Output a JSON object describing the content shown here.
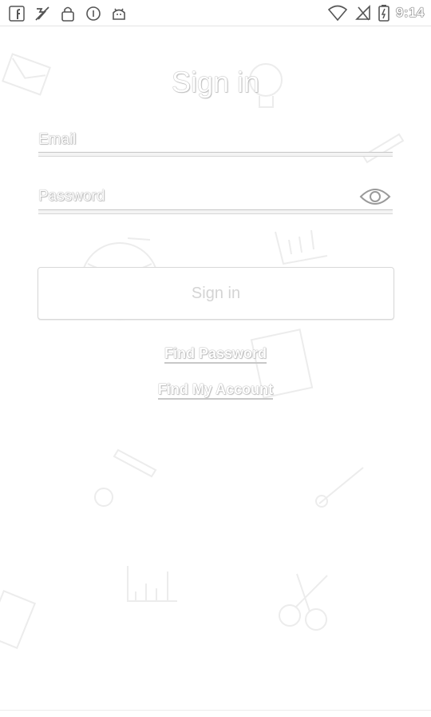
{
  "status_bar": {
    "time": "9:14",
    "left_icons": [
      "facebook-icon",
      "no-sim-icon",
      "lock-icon",
      "circle-app-icon",
      "android-icon"
    ],
    "right_icons": [
      "wifi-icon",
      "no-signal-icon",
      "battery-charging-icon"
    ]
  },
  "screen": {
    "title": "Sign in",
    "email_placeholder": "Email",
    "password_placeholder": "Password",
    "signin_button": "Sign in",
    "find_password": "Find Password",
    "find_account": "Find My Account"
  },
  "colors": {
    "background": "#ffffff",
    "outline": "#9a9a9a",
    "button_text": "#d4d4d4"
  }
}
